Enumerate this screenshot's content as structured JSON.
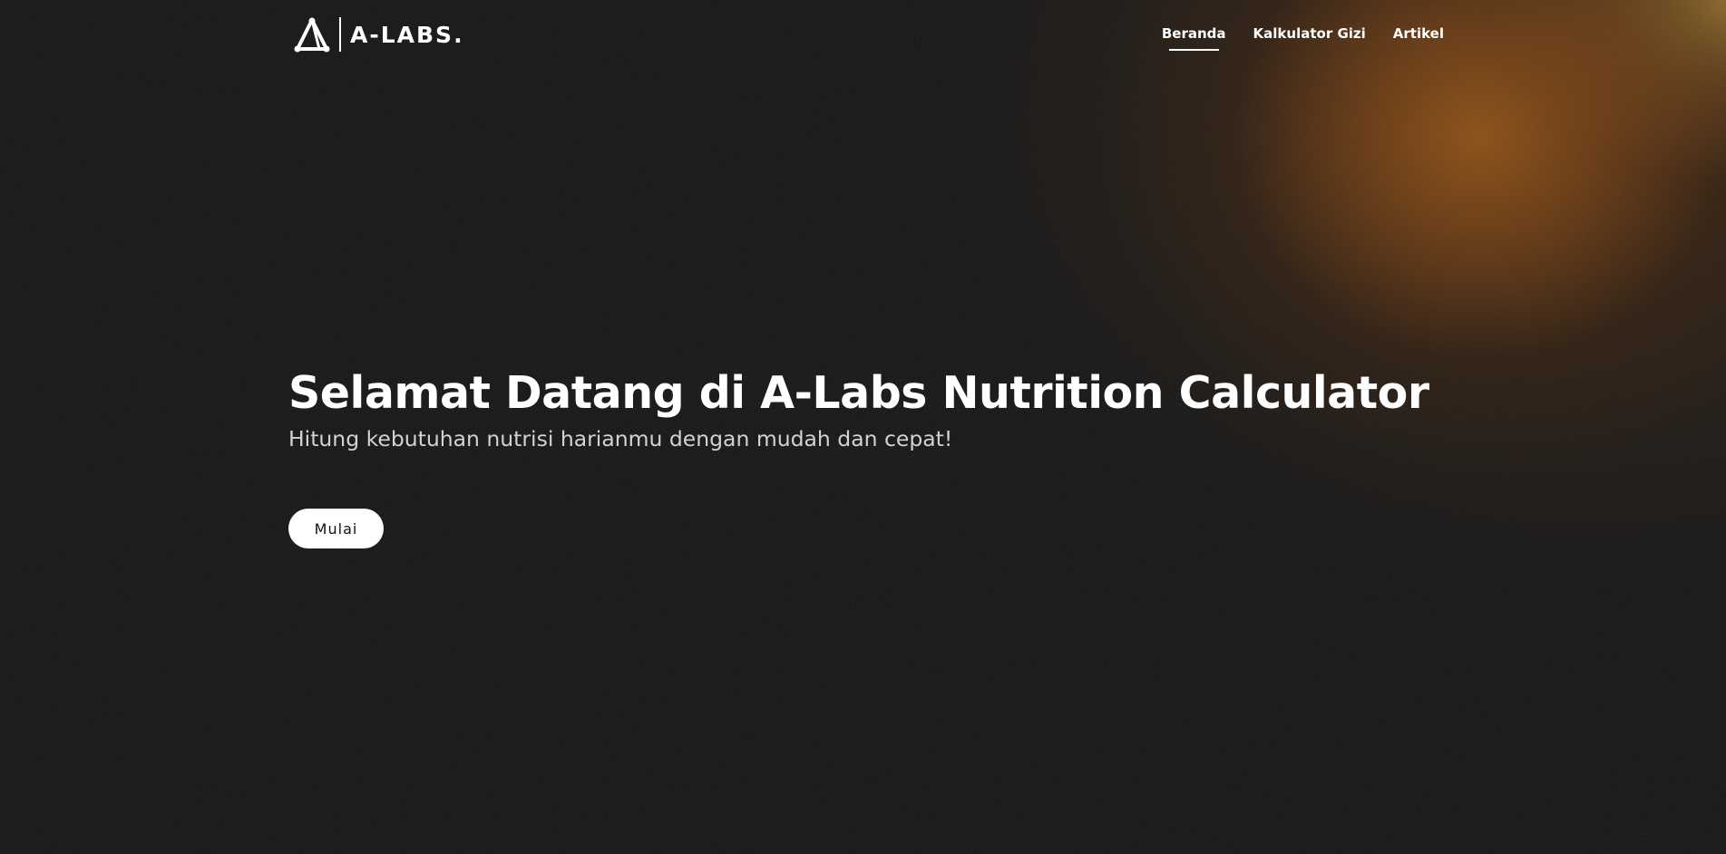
{
  "brand": {
    "name": "A-LABS.",
    "logo_icon": "triangle-nodes-icon"
  },
  "nav": {
    "items": [
      {
        "label": "Beranda",
        "active": true
      },
      {
        "label": "Kalkulator Gizi",
        "active": false
      },
      {
        "label": "Artikel",
        "active": false
      }
    ]
  },
  "hero": {
    "title": "Selamat Datang di A-Labs Nutrition Calculator",
    "subtitle": "Hitung kebutuhan nutrisi harianmu dengan mudah dan cepat!",
    "button_label": "Mulai"
  },
  "colors": {
    "background": "#121212",
    "glow": "#8c4e12",
    "text": "#ffffff",
    "subtitle_text": "#d2d2d2",
    "button_bg": "#ffffff",
    "button_text": "#111111"
  }
}
